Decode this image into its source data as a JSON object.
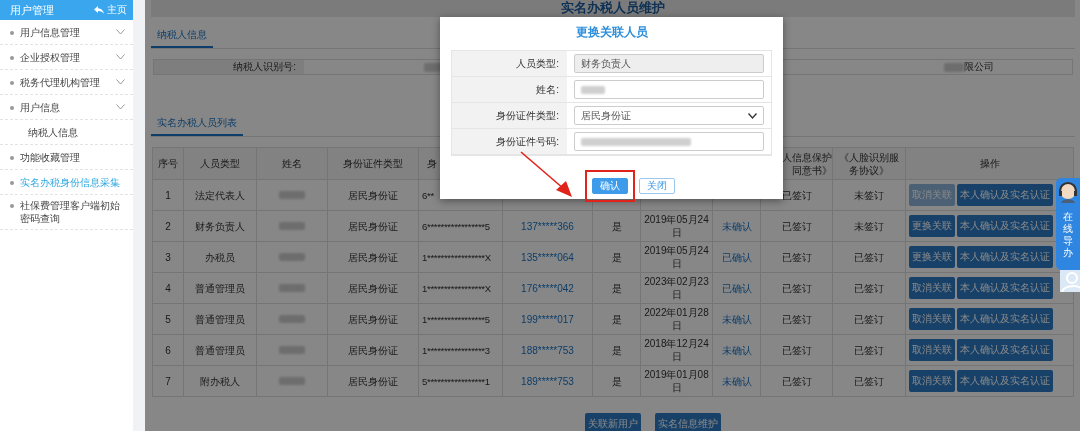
{
  "sidebar": {
    "title": "用户管理",
    "home_link": "主页",
    "items": [
      {
        "label": "用户信息管理",
        "has_submenu": true,
        "selected": false
      },
      {
        "label": "企业授权管理",
        "has_submenu": true,
        "selected": false
      },
      {
        "label": "税务代理机构管理",
        "has_submenu": true,
        "selected": false
      },
      {
        "label": "用户信息",
        "has_submenu": true,
        "selected": false,
        "children": [
          {
            "label": "纳税人信息",
            "selected": false
          }
        ]
      },
      {
        "label": "功能收藏管理",
        "has_submenu": false,
        "selected": false
      },
      {
        "label": "实名办税身份信息采集",
        "has_submenu": false,
        "selected": true
      },
      {
        "label": "社保费管理客户端初始密码查询",
        "has_submenu": false,
        "selected": false
      }
    ]
  },
  "page_title": "实名办税人员维护",
  "taxpayer_tab": "纳税人信息",
  "taxpayer_info": {
    "label": "纳税人识别号:",
    "company_suffix": "限公司"
  },
  "list_tab": "实名办税人员列表",
  "table": {
    "columns": [
      {
        "label": "序号"
      },
      {
        "label": "人员类型"
      },
      {
        "label": "姓名"
      },
      {
        "label": "身份证件类型"
      },
      {
        "label": "身",
        "clipped": true
      },
      null,
      null,
      null,
      null,
      {
        "lines": [
          "人信息保护",
          "同意书》"
        ],
        "clipped": true
      },
      {
        "label": "《人脸识别服务协议》"
      },
      {
        "label": "操作"
      }
    ],
    "rows": [
      {
        "no": "1",
        "type": "法定代表人",
        "id_type": "居民身份证",
        "id_number": "6**",
        "face": "未签订",
        "privacy": "已签订",
        "actions": [
          {
            "label": "取消关联",
            "disabled": true
          },
          {
            "label": "本人确认及实名认证",
            "disabled": false
          }
        ]
      },
      {
        "no": "2",
        "type": "财务负责人",
        "id_type": "居民身份证",
        "id_number": "6*****************5",
        "phone": "137*****366",
        "real": "是",
        "date": "2019年05月24日",
        "confirm": "未确认",
        "privacy": "已签订",
        "face": "未签订",
        "actions": [
          {
            "label": "更换关联",
            "disabled": false
          },
          {
            "label": "本人确认及实名认证",
            "disabled": false
          }
        ]
      },
      {
        "no": "3",
        "type": "办税员",
        "id_type": "居民身份证",
        "id_number": "1*****************X",
        "phone": "135*****064",
        "real": "是",
        "date": "2019年05月24日",
        "confirm": "已确认",
        "privacy": "已签订",
        "face": "已签订",
        "actions": [
          {
            "label": "更换关联",
            "disabled": false
          },
          {
            "label": "本人确认及实名认证",
            "disabled": false
          }
        ]
      },
      {
        "no": "4",
        "type": "普通管理员",
        "id_type": "居民身份证",
        "id_number": "1*****************X",
        "phone": "176*****042",
        "real": "是",
        "date": "2023年02月23日",
        "confirm": "已确认",
        "privacy": "已签订",
        "face": "已签订",
        "actions": [
          {
            "label": "取消关联",
            "disabled": false
          },
          {
            "label": "本人确认及实名认证",
            "disabled": false
          }
        ]
      },
      {
        "no": "5",
        "type": "普通管理员",
        "id_type": "居民身份证",
        "id_number": "1*****************5",
        "phone": "199*****017",
        "real": "是",
        "date": "2022年01月28日",
        "confirm": "未确认",
        "privacy": "已签订",
        "face": "已签订",
        "actions": [
          {
            "label": "取消关联",
            "disabled": false
          },
          {
            "label": "本人确认及实名认证",
            "disabled": false
          }
        ]
      },
      {
        "no": "6",
        "type": "普通管理员",
        "id_type": "居民身份证",
        "id_number": "1*****************3",
        "phone": "188*****753",
        "real": "是",
        "date": "2018年12月24日",
        "confirm": "未确认",
        "privacy": "已签订",
        "face": "已签订",
        "actions": [
          {
            "label": "取消关联",
            "disabled": false
          },
          {
            "label": "本人确认及实名认证",
            "disabled": false
          }
        ]
      },
      {
        "no": "7",
        "type": "附办税人",
        "id_type": "居民身份证",
        "id_number": "5*****************1",
        "phone": "189*****753",
        "real": "是",
        "date": "2019年01月08日",
        "confirm": "未确认",
        "privacy": "已签订",
        "face": "已签订",
        "actions": [
          {
            "label": "取消关联",
            "disabled": false
          },
          {
            "label": "本人确认及实名认证",
            "disabled": false
          }
        ]
      }
    ]
  },
  "bottom_buttons": [
    "关联新用户",
    "实名信息维护"
  ],
  "dialog": {
    "title": "更换关联人员",
    "fields": [
      {
        "label": "人员类型:",
        "kind": "readonly",
        "value": "财务负责人"
      },
      {
        "label": "姓名:",
        "kind": "input"
      },
      {
        "label": "身份证件类型:",
        "kind": "select",
        "value": "居民身份证"
      },
      {
        "label": "身份证件号码:",
        "kind": "input"
      }
    ],
    "buttons": [
      {
        "label": "确认",
        "kind": "primary",
        "highlighted": true
      },
      {
        "label": "关闭",
        "kind": "secondary",
        "highlighted": false
      }
    ]
  },
  "help_widget": {
    "label": "在线导办"
  }
}
